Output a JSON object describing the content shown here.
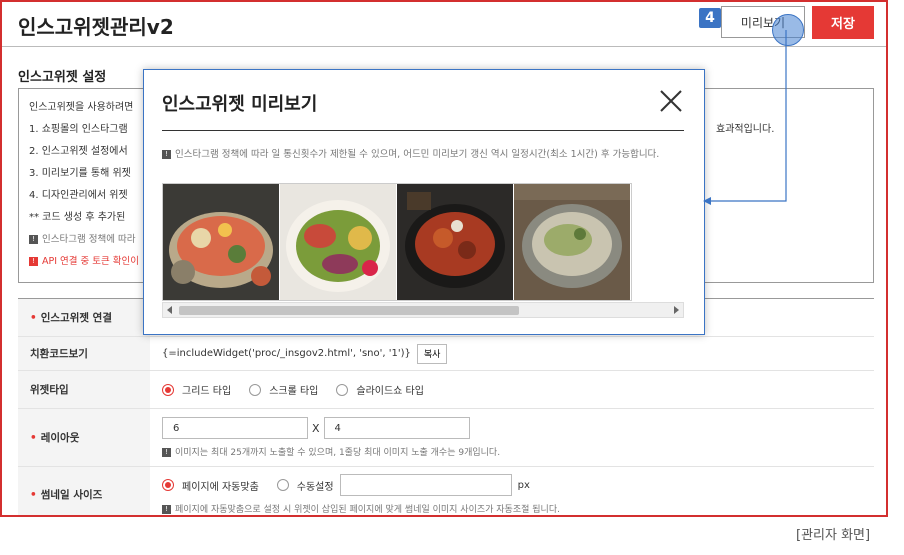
{
  "header": {
    "title": "인스고위젯관리v2",
    "step_number": "4",
    "preview_label": "미리보기",
    "save_label": "저장"
  },
  "settings": {
    "section_title": "인스고위젯 설정",
    "info_lines": [
      "인스고위젯을 사용하려면",
      "1. 쇼핑몰의 인스타그램",
      "2. 인스고위젯 설정에서",
      "3. 미리보기를 통해 위젯",
      "4. 디자인관리에서 위젯",
      "** 코드 생성 후 추가된"
    ],
    "info_warn": "인스타그램 정책에 따라",
    "info_api_warn": "API 연결 중 토큰 확인이",
    "info_tail": "효과적입니다."
  },
  "form": {
    "connection_label": "인스고위젯 연결",
    "code_label": "치환코드보기",
    "code_value": "{=includeWidget('proc/_insgov2.html', 'sno', '1')}",
    "copy_label": "복사",
    "type_label": "위젯타입",
    "type_options": [
      "그리드 타입",
      "스크롤 타입",
      "슬라이드쇼 타입"
    ],
    "type_selected": "그리드 타입",
    "layout_label": "레이아웃",
    "layout_cols": "6",
    "layout_x": "X",
    "layout_rows": "4",
    "layout_hint": "이미지는 최대 25개까지 노출할 수 있으며, 1줄당 최대 이미지 노출 개수는 9개입니다.",
    "thumb_label": "썸네일 사이즈",
    "thumb_options": [
      "페이지에 자동맞춤",
      "수동설정"
    ],
    "thumb_selected": "페이지에 자동맞춤",
    "thumb_unit": "px",
    "thumb_hint": "페이지에 자동맞춤으로 설정 시 위젯이 삽입된 페이지에 맞게 썸네일 이미지 사이즈가 자동조절 됩니다."
  },
  "modal": {
    "title": "인스고위젯 미리보기",
    "note": "인스타그램 정책에 따라 일 통신횟수가 제한될 수 있으며, 어드민 미리보기 갱신 역시 일정시간(최소 1시간) 후 가능합니다."
  },
  "caption": "[관리자 화면]",
  "colors": {
    "accent_red": "#e53935",
    "accent_blue": "#3b74c4"
  }
}
